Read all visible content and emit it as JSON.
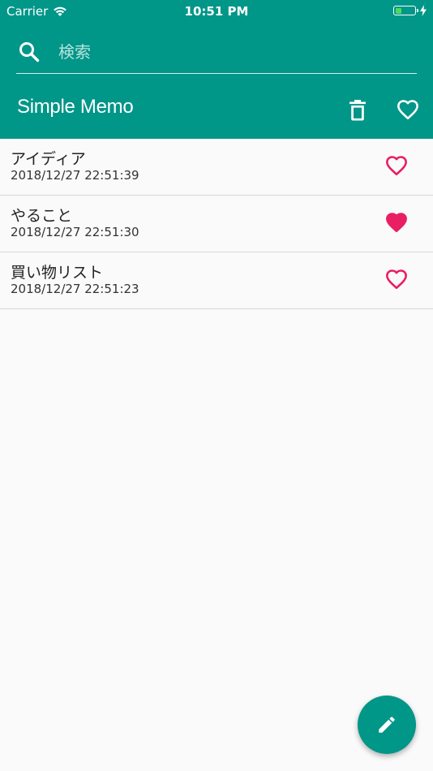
{
  "status_bar": {
    "carrier": "Carrier",
    "time": "10:51 PM",
    "battery_level": 0.35
  },
  "search": {
    "icon": "search-icon",
    "placeholder": "検索",
    "value": ""
  },
  "header": {
    "title": "Simple Memo",
    "trash_icon": "trash-icon",
    "favorite_filter_icon": "heart-outline-icon"
  },
  "memos": [
    {
      "title": "アイディア",
      "date": "2018/12/27 22:51:39",
      "favorite": false
    },
    {
      "title": "やること",
      "date": "2018/12/27 22:51:30",
      "favorite": true
    },
    {
      "title": "買い物リスト",
      "date": "2018/12/27 22:51:23",
      "favorite": false
    }
  ],
  "fab": {
    "icon": "pencil-icon"
  },
  "colors": {
    "primary": "#009688",
    "heart": "#e91e63",
    "background": "#fafafa"
  }
}
